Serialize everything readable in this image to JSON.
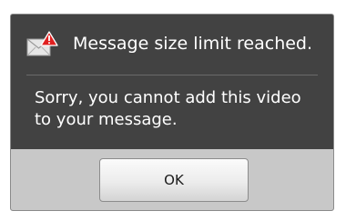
{
  "dialog": {
    "title": "Message size limit reached.",
    "title_icon": "mail-warning-icon",
    "message": "Sorry, you cannot add this video to your message.",
    "ok_label": "OK"
  },
  "colors": {
    "dialog_background": "#424242",
    "button_bar_background": "#c8c8c8",
    "warning_red": "#e02020",
    "text": "#ffffff"
  }
}
